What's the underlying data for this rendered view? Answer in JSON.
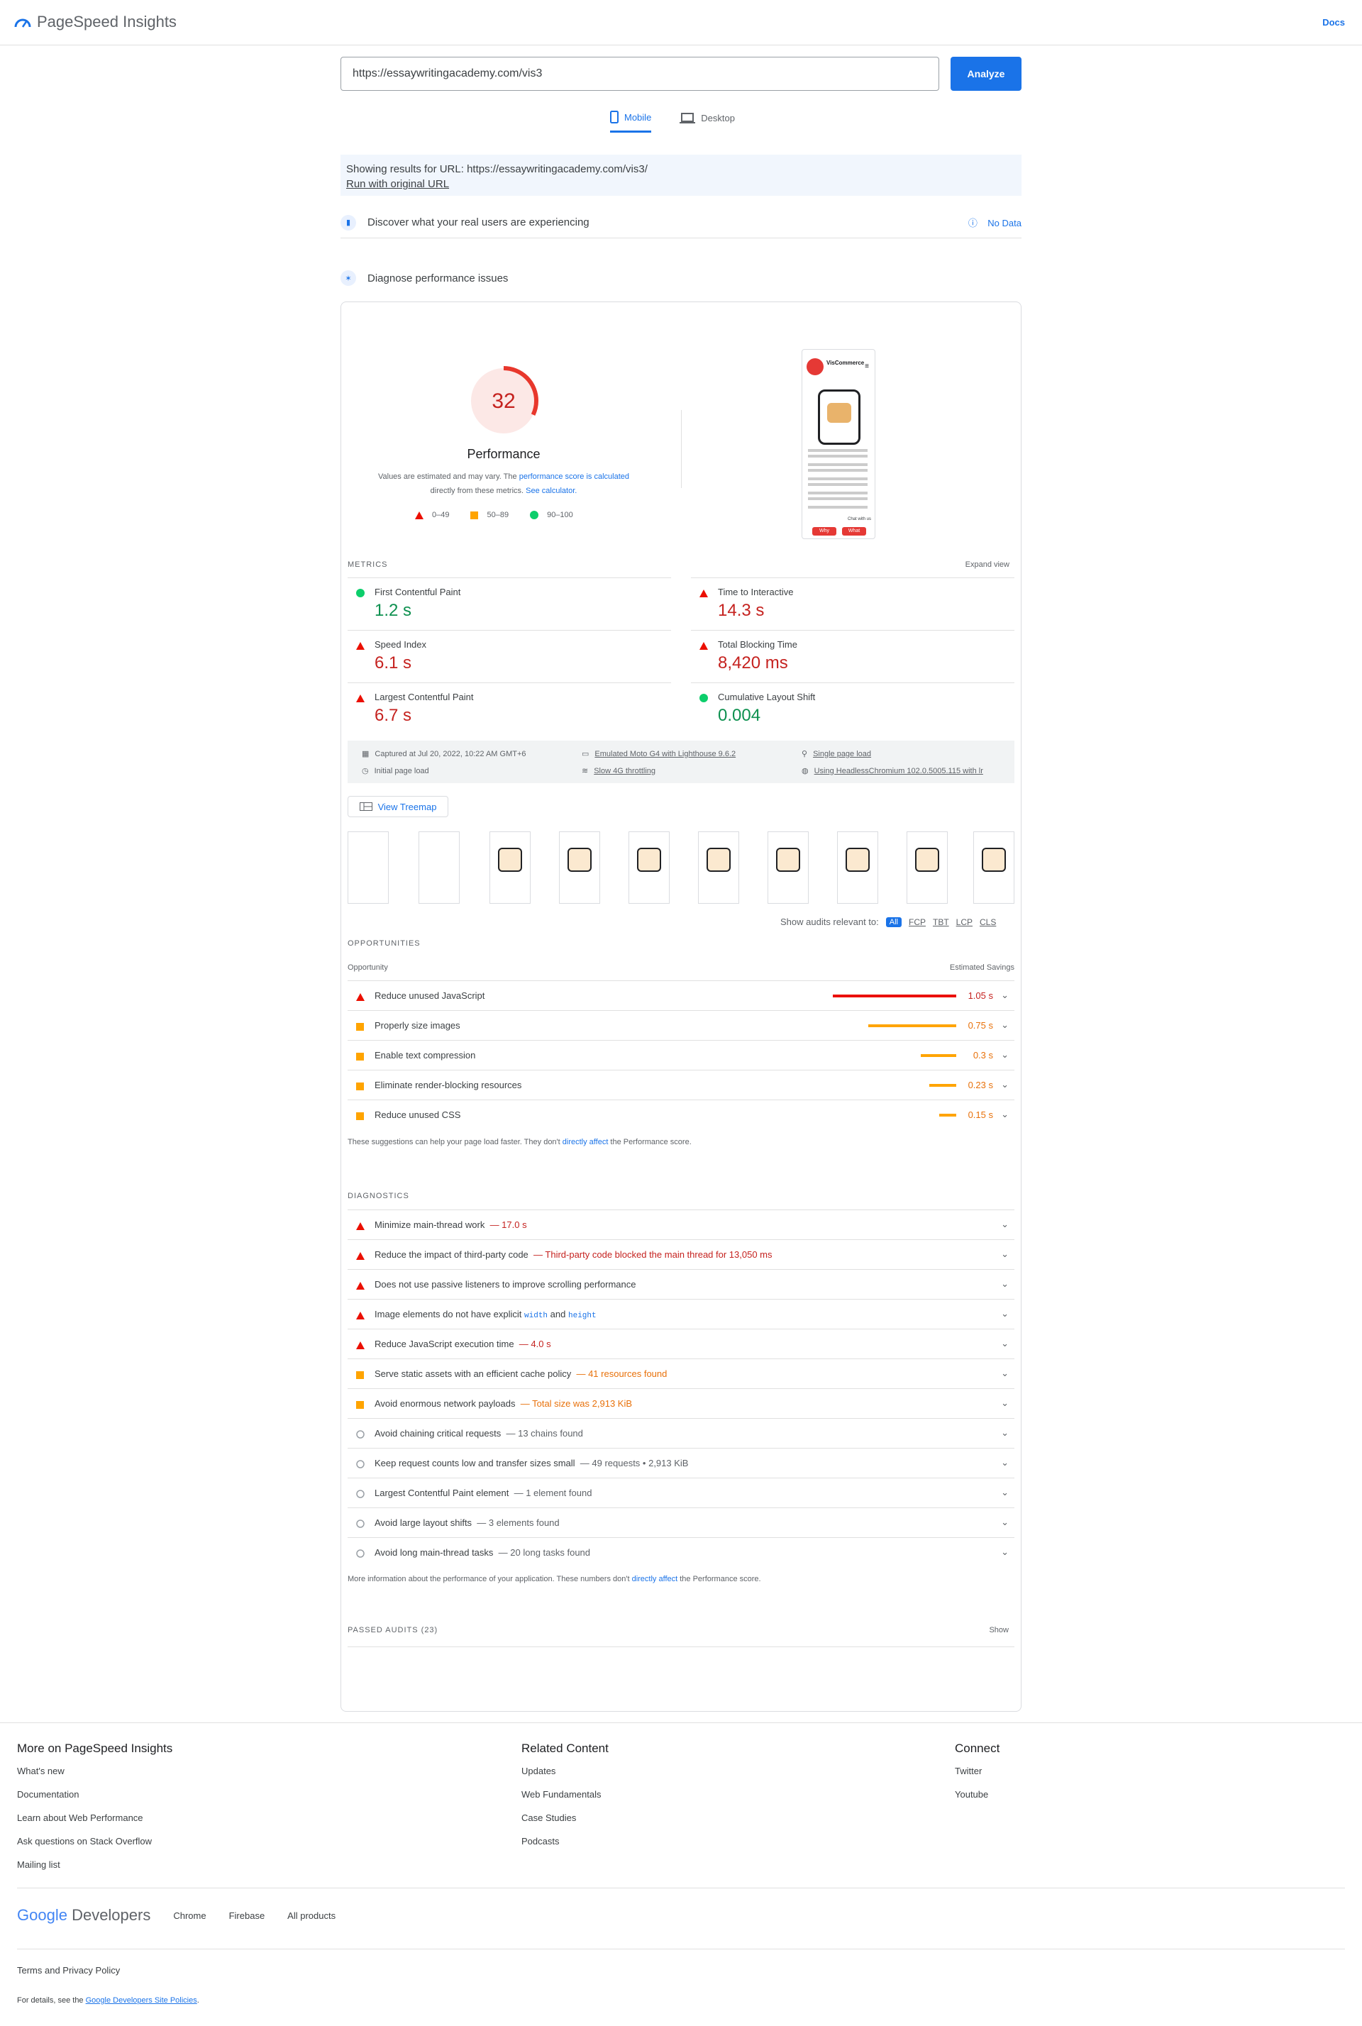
{
  "header": {
    "app_title": "PageSpeed Insights",
    "docs_label": "Docs"
  },
  "search": {
    "url_value": "https://essaywritingacademy.com/vis3",
    "analyze_label": "Analyze"
  },
  "tabs": [
    {
      "label": "Mobile",
      "active": true
    },
    {
      "label": "Desktop",
      "active": false
    }
  ],
  "notice": {
    "showing": "Showing results for URL: https://essaywritingacademy.com/vis3/",
    "run_original": "Run with original URL"
  },
  "field_data": {
    "label": "Discover what your real users are experiencing",
    "status": "No Data"
  },
  "diagnose": {
    "label": "Diagnose performance issues"
  },
  "score": {
    "value": "32",
    "fraction": 0.32,
    "title": "Performance",
    "note_pre": "Values are estimated and may vary. The ",
    "note_link1": "performance score is calculated",
    "note_mid": "directly from these metrics. ",
    "note_link2": "See calculator."
  },
  "legend": [
    "0–49",
    "50–89",
    "90–100"
  ],
  "screenshot": {
    "brand": "VisCommerce",
    "cta1": "Why",
    "cta2": "What",
    "chat": "Chat with us"
  },
  "metrics_section": {
    "title": "METRICS",
    "expand": "Expand view"
  },
  "metrics": [
    {
      "name": "First Contentful Paint",
      "value": "1.2 s",
      "status": "pass"
    },
    {
      "name": "Time to Interactive",
      "value": "14.3 s",
      "status": "fail"
    },
    {
      "name": "Speed Index",
      "value": "6.1 s",
      "status": "fail"
    },
    {
      "name": "Total Blocking Time",
      "value": "8,420 ms",
      "status": "fail"
    },
    {
      "name": "Largest Contentful Paint",
      "value": "6.7 s",
      "status": "fail"
    },
    {
      "name": "Cumulative Layout Shift",
      "value": "0.004",
      "status": "pass"
    }
  ],
  "runinfo": {
    "captured": "Captured at Jul 20, 2022, 10:22 AM GMT+6",
    "device": "Emulated Moto G4 with Lighthouse 9.6.2",
    "load": "Single page load",
    "initial": "Initial page load",
    "throttle": "Slow 4G throttling",
    "browser": "Using HeadlessChromium 102.0.5005.115 with lr"
  },
  "treemap_label": "View Treemap",
  "audit_filter": {
    "label": "Show audits relevant to:",
    "options": [
      "All",
      "FCP",
      "TBT",
      "LCP",
      "CLS"
    ]
  },
  "opportunities": {
    "title": "OPPORTUNITIES",
    "col1": "Opportunity",
    "col2": "Estimated Savings",
    "items": [
      {
        "name": "Reduce unused JavaScript",
        "value": "1.05 s",
        "fraction": 1.0,
        "status": "fail"
      },
      {
        "name": "Properly size images",
        "value": "0.75 s",
        "fraction": 0.71,
        "status": "avg"
      },
      {
        "name": "Enable text compression",
        "value": "0.3 s",
        "fraction": 0.29,
        "status": "avg"
      },
      {
        "name": "Eliminate render-blocking resources",
        "value": "0.23 s",
        "fraction": 0.22,
        "status": "avg"
      },
      {
        "name": "Reduce unused CSS",
        "value": "0.15 s",
        "fraction": 0.14,
        "status": "avg"
      }
    ],
    "note_pre": "These suggestions can help your page load faster. They don't ",
    "note_link": "directly affect",
    "note_post": " the Performance score."
  },
  "diagnostics": {
    "title": "DIAGNOSTICS",
    "items": [
      {
        "name": "Minimize main-thread work",
        "detail": "— 17.0 s",
        "status": "fail"
      },
      {
        "name": "Reduce the impact of third-party code",
        "detail": "— Third-party code blocked the main thread for 13,050 ms",
        "status": "fail"
      },
      {
        "name": "Does not use passive listeners to improve scrolling performance",
        "detail": "",
        "status": "fail"
      },
      {
        "name": "Image elements do not have explicit",
        "code1": "width",
        "and": "and",
        "code2": "height",
        "detail": "",
        "status": "fail"
      },
      {
        "name": "Reduce JavaScript execution time",
        "detail": "— 4.0 s",
        "status": "fail"
      },
      {
        "name": "Serve static assets with an efficient cache policy",
        "detail": "— 41 resources found",
        "status": "avg"
      },
      {
        "name": "Avoid enormous network payloads",
        "detail": "— Total size was 2,913 KiB",
        "status": "avg"
      },
      {
        "name": "Avoid chaining critical requests",
        "detail": "— 13 chains found",
        "status": "info"
      },
      {
        "name": "Keep request counts low and transfer sizes small",
        "detail": "— 49 requests • 2,913 KiB",
        "status": "info"
      },
      {
        "name": "Largest Contentful Paint element",
        "detail": "— 1 element found",
        "status": "info"
      },
      {
        "name": "Avoid large layout shifts",
        "detail": "— 3 elements found",
        "status": "info"
      },
      {
        "name": "Avoid long main-thread tasks",
        "detail": "— 20 long tasks found",
        "status": "info"
      }
    ],
    "note_pre": "More information about the performance of your application. These numbers don't ",
    "note_link": "directly affect",
    "note_post": " the Performance score."
  },
  "passed": {
    "title": "PASSED AUDITS (23)",
    "show": "Show"
  },
  "footer": {
    "col1": {
      "title": "More on PageSpeed Insights",
      "links": [
        "What's new",
        "Documentation",
        "Learn about Web Performance",
        "Ask questions on Stack Overflow",
        "Mailing list"
      ]
    },
    "col2": {
      "title": "Related Content",
      "links": [
        "Updates",
        "Web Fundamentals",
        "Case Studies",
        "Podcasts"
      ]
    },
    "col3": {
      "title": "Connect",
      "links": [
        "Twitter",
        "Youtube"
      ]
    },
    "brand_google": "Google",
    "brand_dev": " Developers",
    "products": [
      "Chrome",
      "Firebase",
      "All products"
    ],
    "terms": "Terms and Privacy Policy",
    "details_pre": "For details, see the ",
    "details_link": "Google Developers Site Policies",
    "details_post": "."
  },
  "colors": {
    "fail": "#c5221f",
    "avg": "#f4a21e",
    "pass": "#0cce6b",
    "accent": "#1a73e8"
  }
}
